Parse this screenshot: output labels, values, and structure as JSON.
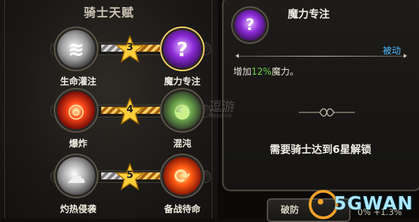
{
  "panel": {
    "title": "骑士天赋"
  },
  "talent_rows": [
    {
      "left": {
        "name": "生命灌注",
        "icon": "swirl-vortex-icon",
        "glyph": "≋"
      },
      "level": "3",
      "right": {
        "name": "魔力专注",
        "icon": "question-mark-icon",
        "glyph": "?"
      }
    },
    {
      "left": {
        "name": "爆炸",
        "icon": "target-reticle-icon",
        "glyph": "◎"
      },
      "level": "4",
      "right": {
        "name": "混沌",
        "icon": "chomping-creature-icon",
        "glyph": "◕"
      }
    },
    {
      "left": {
        "name": "灼热侵袭",
        "icon": "smoke-cloud-icon",
        "glyph": "☁"
      },
      "level": "5",
      "right": {
        "name": "备战待命",
        "icon": "flame-swirl-icon",
        "glyph": "⟳"
      }
    }
  ],
  "detail": {
    "name": "魔力专注",
    "type": "被动",
    "desc_prefix": "增加",
    "desc_value": "12%",
    "desc_suffix": "魔力。",
    "unlock_text": "需要骑士达到6星解锁",
    "icon": "question-mark-icon",
    "glyph": "?"
  },
  "bottom": {
    "button_label": "破防",
    "percent_text": "0%  +1.3%"
  },
  "watermarks": {
    "site1": "逗游",
    "site1_sub": "doyo.cn",
    "site2": "5GWAN"
  },
  "colors": {
    "accent_blue": "#4fb9ff",
    "percent_green": "#6ad24a",
    "star_gold": "#ffcf3b"
  }
}
